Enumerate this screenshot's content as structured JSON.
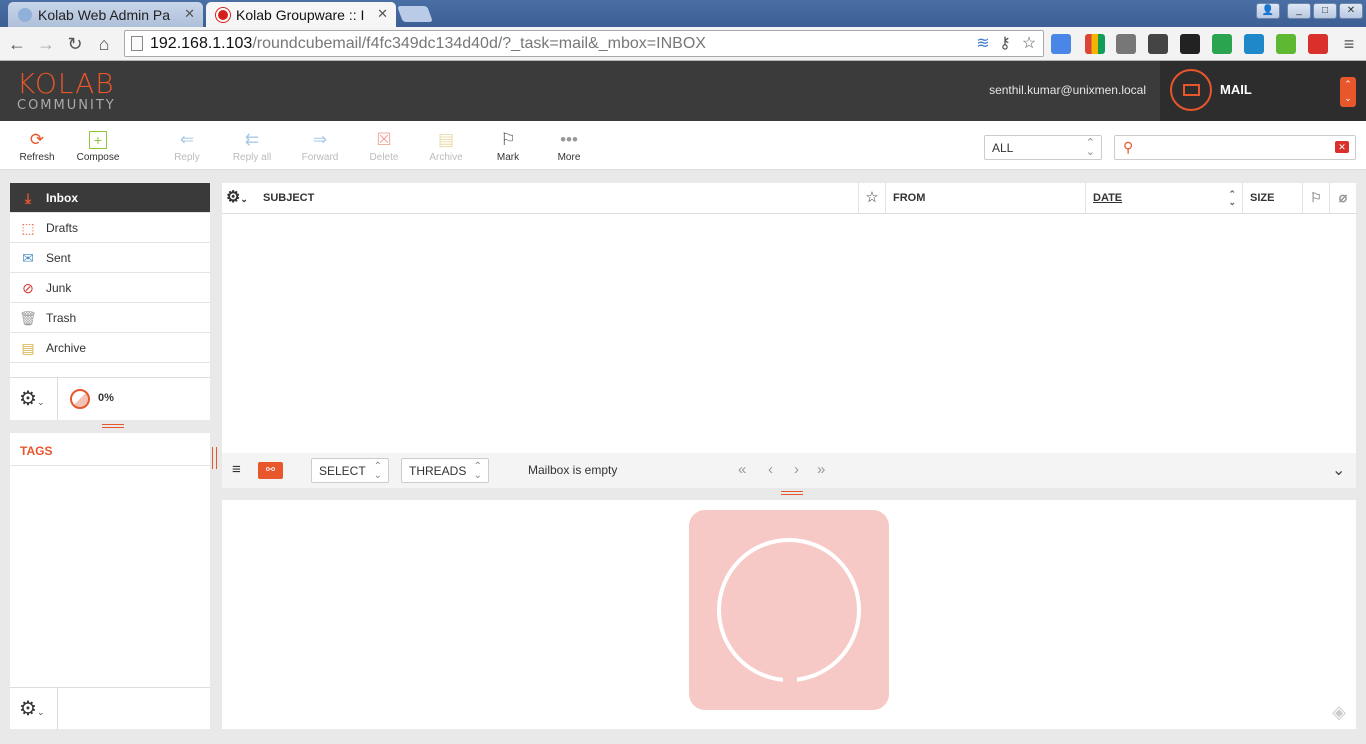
{
  "browser": {
    "tabs": [
      {
        "title": "Kolab Web Admin Pa"
      },
      {
        "title": "Kolab Groupware :: I"
      }
    ],
    "url_host": "192.168.1.103",
    "url_path": "/roundcubemail/f4fc349dc134d40d/?_task=mail&_mbox=INBOX"
  },
  "header": {
    "logo_top": "KOLAB",
    "logo_bottom": "COMMUNITY",
    "user": "senthil.kumar@unixmen.local",
    "task": "MAIL"
  },
  "toolbar": {
    "refresh": "Refresh",
    "compose": "Compose",
    "reply": "Reply",
    "reply_all": "Reply all",
    "forward": "Forward",
    "delete": "Delete",
    "archive": "Archive",
    "mark": "Mark",
    "more": "More",
    "filter": "ALL",
    "search_placeholder": ""
  },
  "folders": [
    {
      "label": "Inbox",
      "icon": "inbox-icon"
    },
    {
      "label": "Drafts",
      "icon": "drafts-icon"
    },
    {
      "label": "Sent",
      "icon": "sent-icon"
    },
    {
      "label": "Junk",
      "icon": "junk-icon"
    },
    {
      "label": "Trash",
      "icon": "trash-icon"
    },
    {
      "label": "Archive",
      "icon": "archive-icon"
    }
  ],
  "quota": "0%",
  "tags_header": "TAGS",
  "list": {
    "columns": {
      "subject": "SUBJECT",
      "from": "FROM",
      "date": "DATE",
      "size": "SIZE"
    },
    "select": "SELECT",
    "threads": "THREADS",
    "status": "Mailbox is empty"
  },
  "colors": {
    "accent": "#e8562b",
    "header_bg": "#3b3b3b",
    "watermark": "#f7c9c6"
  }
}
